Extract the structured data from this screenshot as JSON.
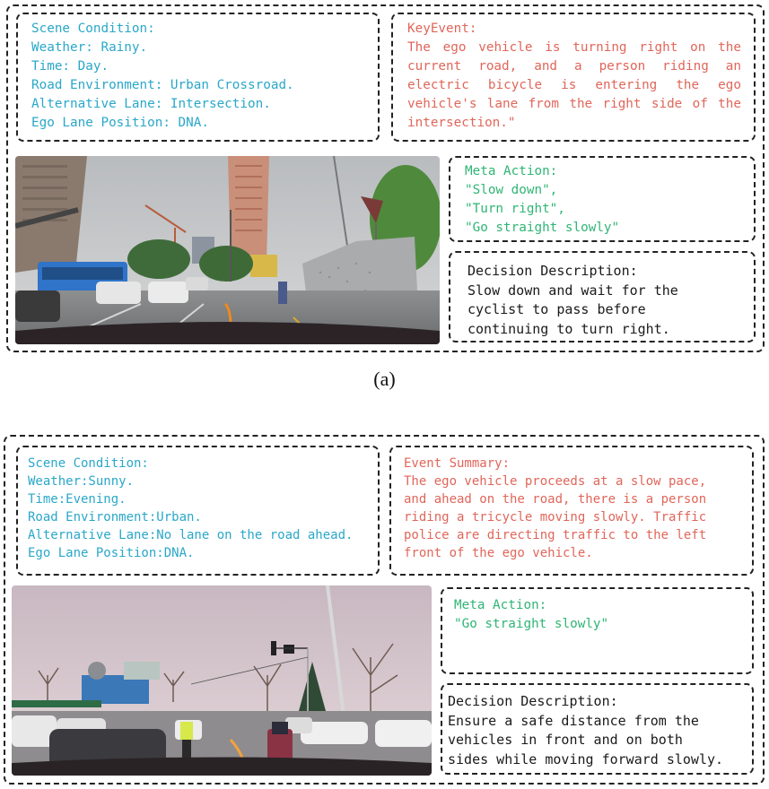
{
  "panel_a": {
    "scene_condition": {
      "title": "Scene Condition:",
      "lines": [
        "Weather: Rainy.",
        "Time: Day.",
        "Road Environment: Urban Crossroad.",
        "Alternative Lane: Intersection.",
        "Ego Lane Position: DNA."
      ]
    },
    "key_event": {
      "title": "KeyEvent:",
      "text": "The ego vehicle is turning right on the current road, and a person riding an electric bicycle is entering the ego vehicle's lane from the right side of the intersection.\""
    },
    "meta_action": {
      "title": "Meta Action:",
      "lines": [
        "\"Slow down\",",
        "\"Turn right\",",
        "\"Go straight slowly\""
      ]
    },
    "decision": {
      "title": "Decision Description:",
      "lines": [
        "Slow down and wait for the",
        "cyclist to pass before",
        "continuing to turn right."
      ]
    },
    "image": {
      "description": "Rainy urban crossroad dashcam view with cyclist entering lane from right"
    },
    "caption": "(a)"
  },
  "panel_b": {
    "scene_condition": {
      "title": "Scene Condition:",
      "lines": [
        "Weather:Sunny.",
        "Time:Evening.",
        "Road Environment:Urban.",
        "Alternative Lane:No lane on the road ahead.",
        "Ego Lane Position:DNA."
      ]
    },
    "event_summary": {
      "title": "Event Summary:",
      "lines": [
        "The ego vehicle proceeds at a slow pace,",
        "and ahead on the road, there is a person",
        "riding a tricycle moving slowly. Traffic",
        "police are directing traffic to the left",
        "front of the ego vehicle."
      ]
    },
    "meta_action": {
      "title": "Meta Action:",
      "lines": [
        "\"Go straight slowly\""
      ]
    },
    "decision": {
      "title": "Decision Description:",
      "lines": [
        "Ensure a safe distance from the",
        "vehicles in front and on both",
        "sides while moving forward slowly."
      ]
    },
    "image": {
      "description": "Evening urban road dashcam view with traffic police and tricycle ahead"
    }
  },
  "colors": {
    "scene": "#2aa7c9",
    "event": "#e0665a",
    "action": "#2fb574",
    "decision": "#1a1a1a"
  }
}
